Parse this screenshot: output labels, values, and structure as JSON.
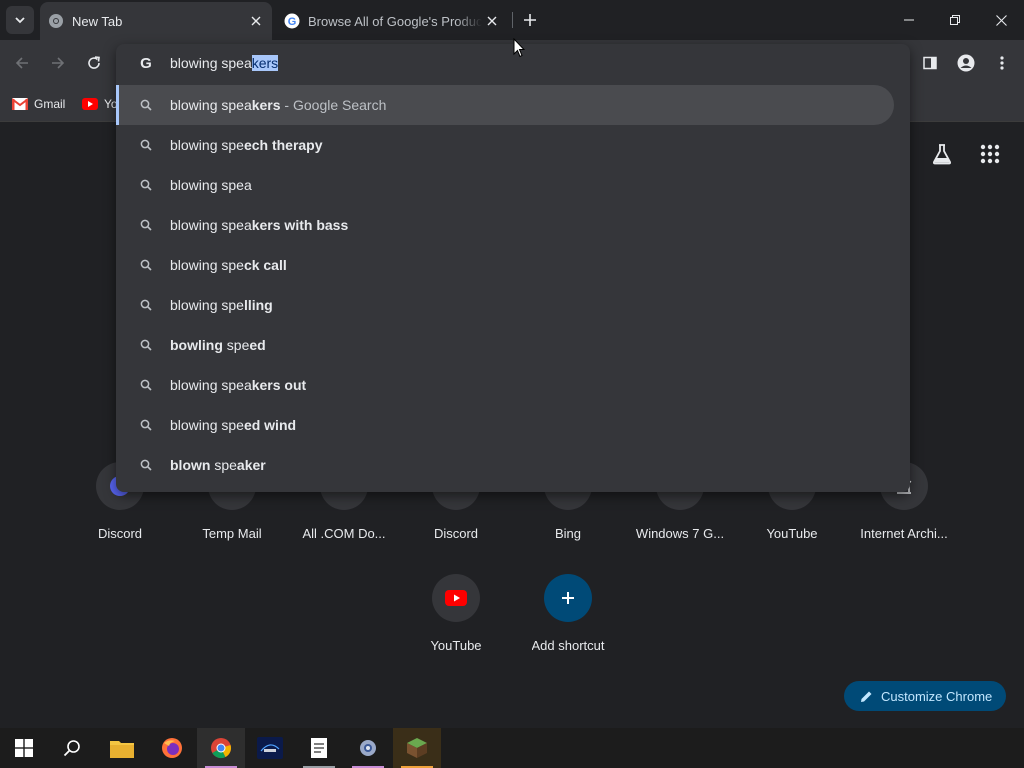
{
  "tabs": [
    {
      "title": "New Tab",
      "active": true
    },
    {
      "title": "Browse All of Google's Products",
      "active": false
    }
  ],
  "omnibox": {
    "typed": "blowing spea",
    "autocomplete": "kers"
  },
  "suggestions": [
    {
      "typed": "blowing spea",
      "completion": "kers",
      "suffix": " - Google Search"
    },
    {
      "typed": "blowing spe",
      "completion": "ech therapy",
      "suffix": ""
    },
    {
      "typed": "blowing spea",
      "completion": "",
      "suffix": ""
    },
    {
      "typed": "blowing spea",
      "completion": "kers with bass",
      "suffix": ""
    },
    {
      "typed": "blowing spe",
      "completion": "ck call",
      "suffix": ""
    },
    {
      "typed": "blowing spe",
      "completion": "lling",
      "suffix": ""
    },
    {
      "typed": "",
      "completion": "bowling",
      "suffix": "",
      "tail": " spe",
      "tail2": "ed"
    },
    {
      "typed": "blowing spea",
      "completion": "kers out",
      "suffix": ""
    },
    {
      "typed": "blowing spe",
      "completion": "ed wind",
      "suffix": ""
    },
    {
      "typed": "",
      "completion": "blown",
      "suffix": "",
      "tail": " spe",
      "tail2": "aker"
    }
  ],
  "bookmarks": [
    {
      "label": "Gmail"
    },
    {
      "label": "Yo"
    }
  ],
  "shortcuts_row1": [
    {
      "label": "Discord"
    },
    {
      "label": "Temp Mail"
    },
    {
      "label": "All .COM Do..."
    },
    {
      "label": "Discord"
    },
    {
      "label": "Bing"
    },
    {
      "label": "Windows 7 G..."
    },
    {
      "label": "YouTube"
    },
    {
      "label": "Internet Archi..."
    }
  ],
  "shortcuts_row2": [
    {
      "label": "YouTube"
    },
    {
      "label": "Add shortcut"
    }
  ],
  "customize_label": "Customize Chrome",
  "colors": {
    "accent": "#a8c7fa",
    "customize_bg": "#004a77",
    "add_shortcut_bg": "#0b57d0"
  }
}
